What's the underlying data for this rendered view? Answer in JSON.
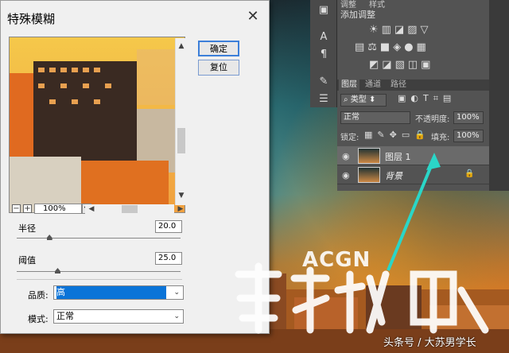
{
  "dialog": {
    "title": "特殊模糊",
    "close": "✕",
    "ok": "确定",
    "reset": "复位",
    "zoom": "100%",
    "zoom_minus": "−",
    "zoom_plus": "+",
    "radius_label": "半径",
    "radius_value": "20.0",
    "radius_fraction": 0.2,
    "threshold_label": "阈值",
    "threshold_value": "25.0",
    "threshold_fraction": 0.25,
    "quality_label": "品质:",
    "quality_value": "高",
    "mode_label": "模式:",
    "mode_value": "正常"
  },
  "panel": {
    "tab_adjust": "调整",
    "tab_style": "样式",
    "adjust_title": "添加调整",
    "layers_tab": "图层",
    "channels_tab": "通道",
    "paths_tab": "路径",
    "filter_kind": "类型",
    "blend_mode": "正常",
    "opacity_label": "不透明度:",
    "opacity_value": "100%",
    "lock_label": "锁定:",
    "fill_label": "填充:",
    "fill_value": "100%",
    "layers": [
      {
        "name": "图层 1",
        "selected": true
      },
      {
        "name": "背景",
        "selected": false,
        "italic": true
      }
    ]
  },
  "watermark": {
    "brand": "ACGN",
    "footer": "头条号 / 大苏男学长"
  },
  "colors": {
    "accent": "#0a74d8",
    "arrow": "#2ad6c8",
    "panel": "#535353"
  }
}
